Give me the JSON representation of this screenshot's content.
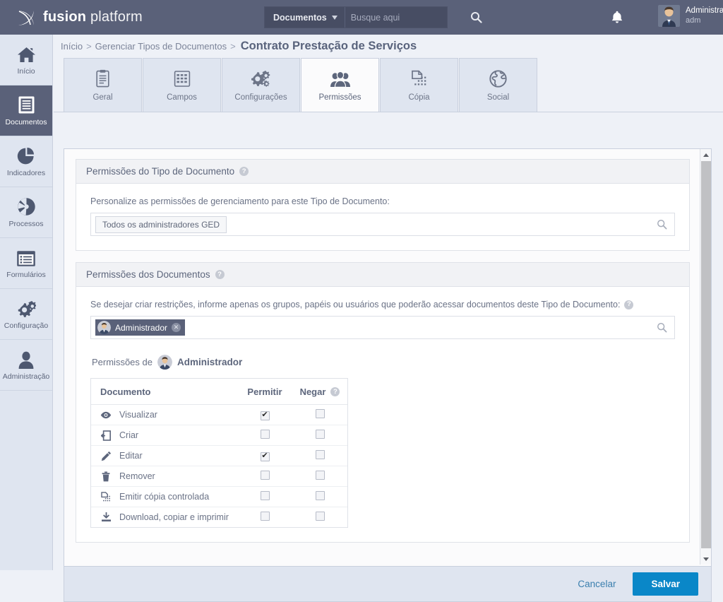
{
  "brand": {
    "bold": "fusion",
    "light": " platform",
    "logo_icon": "fusion-logo-icon"
  },
  "search": {
    "scope_label": "Documentos",
    "placeholder": "Busque aqui",
    "value": "",
    "search_icon": "search-icon",
    "caret_icon": "chevron-down-icon"
  },
  "header": {
    "bell_icon": "notification-bell-icon",
    "user_name": "Administrador",
    "user_login": "adm",
    "avatar_icon": "user-avatar"
  },
  "sidebar": {
    "items": [
      {
        "label": "Início",
        "icon": "home-icon",
        "active": false
      },
      {
        "label": "Documentos",
        "icon": "document-icon",
        "active": true
      },
      {
        "label": "Indicadores",
        "icon": "pie-chart-icon",
        "active": false
      },
      {
        "label": "Processos",
        "icon": "aperture-icon",
        "active": false
      },
      {
        "label": "Formulários",
        "icon": "form-list-icon",
        "active": false
      },
      {
        "label": "Configuração",
        "icon": "gears-icon",
        "active": false
      },
      {
        "label": "Administração",
        "icon": "person-icon",
        "active": false
      }
    ]
  },
  "breadcrumb": {
    "items": [
      "Início",
      "Gerenciar Tipos de Documentos"
    ],
    "separator": ">",
    "current": "Contrato Prestação de Serviços"
  },
  "tabs": [
    {
      "label": "Geral",
      "icon": "clipboard-icon",
      "active": false
    },
    {
      "label": "Campos",
      "icon": "fields-grid-icon",
      "active": false
    },
    {
      "label": "Configurações",
      "icon": "gears-icon",
      "active": false
    },
    {
      "label": "Permissões",
      "icon": "users-icon",
      "active": true
    },
    {
      "label": "Cópia",
      "icon": "copy-page-icon",
      "active": false
    },
    {
      "label": "Social",
      "icon": "globe-icon",
      "active": false
    }
  ],
  "panel_doctype": {
    "title": "Permissões do Tipo de Documento",
    "help_icon": "help-icon",
    "help_glyph": "?",
    "field_label": "Personalize as permissões de gerenciamento para este Tipo de Documento:",
    "chips": [
      {
        "label": "Todos os administradores GED"
      }
    ],
    "search_icon": "search-icon"
  },
  "panel_documents": {
    "title": "Permissões dos Documentos",
    "help_icon": "help-icon",
    "help_glyph": "?",
    "field_label": "Se desejar criar restrições, informe apenas os grupos, papéis ou usuários que poderão acessar documentos deste Tipo de Documento:",
    "chips": [
      {
        "label": "Administrador",
        "remove_glyph": "✕"
      }
    ],
    "search_icon": "search-icon",
    "perm_of_prefix": "Permissões de",
    "perm_of_who": "Administrador",
    "table": {
      "headers": {
        "name": "Documento",
        "allow": "Permitir",
        "deny": "Negar"
      },
      "help_glyph": "?",
      "rows": [
        {
          "label": "Visualizar",
          "icon": "eye-icon",
          "allow": true,
          "deny": false
        },
        {
          "label": "Criar",
          "icon": "create-document-icon",
          "allow": false,
          "deny": false
        },
        {
          "label": "Editar",
          "icon": "pencil-icon",
          "allow": true,
          "deny": false
        },
        {
          "label": "Remover",
          "icon": "trash-icon",
          "allow": false,
          "deny": false
        },
        {
          "label": "Emitir cópia controlada",
          "icon": "copy-page-icon",
          "allow": false,
          "deny": false
        },
        {
          "label": "Download, copiar e imprimir",
          "icon": "download-icon",
          "allow": false,
          "deny": false
        }
      ]
    }
  },
  "footer": {
    "cancel_label": "Cancelar",
    "save_label": "Salvar"
  },
  "scrollbar": {
    "up_icon": "scroll-up-arrow-icon",
    "down_icon": "scroll-down-arrow-icon"
  },
  "colors": {
    "topbar": "#5a6179",
    "sidebar": "#dfe5f0",
    "accent_save": "#0a87c8",
    "link": "#3b7fae",
    "text": "#5d667c"
  }
}
